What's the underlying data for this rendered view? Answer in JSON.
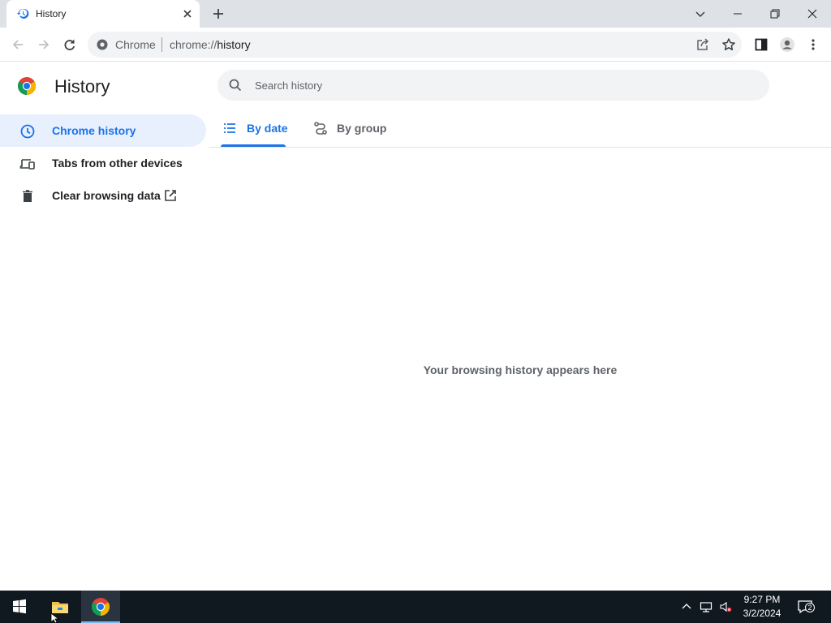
{
  "tab": {
    "title": "History"
  },
  "omnibox": {
    "site_chip": "Chrome",
    "url_scheme": "chrome://",
    "url_path": "history"
  },
  "page": {
    "title": "History",
    "search_placeholder": "Search history",
    "sidebar": {
      "items": [
        {
          "label": "Chrome history",
          "icon": "clock-icon",
          "active": true
        },
        {
          "label": "Tabs from other devices",
          "icon": "devices-icon",
          "active": false
        },
        {
          "label": "Clear browsing data",
          "icon": "trash-icon",
          "active": false,
          "trailing_icon": "open-in-new-icon"
        }
      ]
    },
    "view_tabs": [
      {
        "label": "By date",
        "icon": "list-icon",
        "selected": true
      },
      {
        "label": "By group",
        "icon": "journeys-icon",
        "selected": false
      }
    ],
    "empty_message": "Your browsing history appears here"
  },
  "taskbar": {
    "time": "9:27 PM",
    "date": "3/2/2024",
    "notification_count": "2",
    "apps": [
      "start-icon",
      "file-explorer-icon",
      "chrome-icon"
    ]
  },
  "colors": {
    "accent": "#1a73e8",
    "active_bg": "#e8f0fe",
    "tabstrip": "#dee1e6",
    "taskbar": "#101820"
  }
}
